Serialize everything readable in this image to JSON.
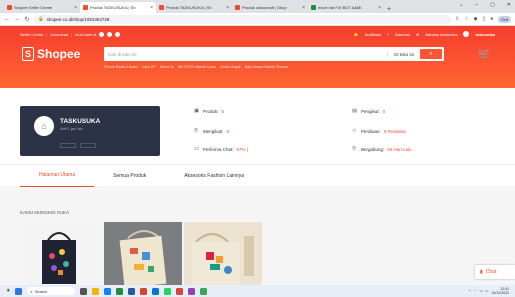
{
  "browser": {
    "tabs": [
      {
        "title": "Shopee Seller Centre",
        "active": false,
        "icon": "shopee-icon"
      },
      {
        "title": "Produk TASKUSUKA | Sh",
        "active": true,
        "icon": "shopee-icon"
      },
      {
        "title": "Produk TASKUSUKA | Sh",
        "active": false,
        "icon": "shopee-icon"
      },
      {
        "title": "Produk coksocraft | Shop",
        "active": false,
        "icon": "shopee-icon"
      },
      {
        "title": "excel rab FIX BGT AAMI",
        "active": false,
        "icon": "sheets-icon"
      }
    ],
    "new_tab": "+",
    "url": "shopee.co.id/shop/1053484728",
    "exit_label": "Exit"
  },
  "topnav": {
    "seller_centre": "Seller Centre",
    "download": "Download",
    "follow": "Ikuti kami di",
    "notif": "Notifikasi",
    "help": "Bantuan",
    "language": "Bahasa Indonesia",
    "username": "taskusuka"
  },
  "header": {
    "logo_text": "Shopee",
    "search_placeholder": "Cari di toko ini",
    "search_scope": "Di toko ini",
    "suggestions": [
      "iPhone Beats 6 Bulan",
      "Case HP",
      "Serba 1k",
      "Set OOTD Wanita Korea",
      "Gratis Ongkir",
      "Baju Atasan Wanita Terbaru"
    ]
  },
  "shop": {
    "name": "TASKUSUKA",
    "subtitle": "Aktif 1 jam lalu",
    "stats": [
      {
        "label": "Produk:",
        "value": "5",
        "icon": "store-icon"
      },
      {
        "label": "Mengikuti:",
        "value": "0",
        "icon": "user-plus-icon"
      },
      {
        "label": "Performa Chat:",
        "value": "57% (",
        "icon": "chat-icon"
      },
      {
        "label": "Pengikut:",
        "value": "0",
        "icon": "followers-icon"
      },
      {
        "label": "Penilaian:",
        "value": "0 Penilaian",
        "icon": "star-icon"
      },
      {
        "label": "Bergabung:",
        "value": "50 Hari Lalu",
        "icon": "user-icon"
      }
    ]
  },
  "tabs": [
    "Halaman Utama",
    "Semua Produk",
    "Aksesoris Fashion Lainnya"
  ],
  "section_title": "KAMU MUNGKIN SUKA",
  "chat_label": "Chat",
  "taskbar": {
    "search": "Search",
    "time": "12:01",
    "date": "10/12/2023"
  }
}
